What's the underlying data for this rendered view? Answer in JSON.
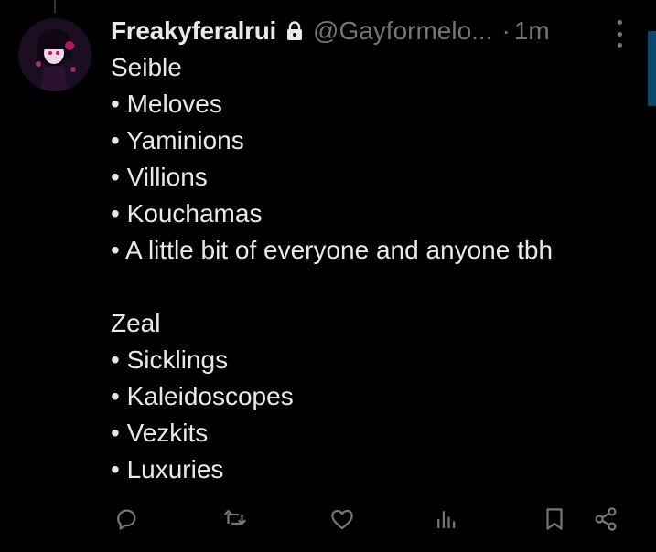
{
  "tweet": {
    "display_name": "Freakyferalrui",
    "handle": "@Gayformelo...",
    "separator": "·",
    "time": "1m",
    "lines": [
      "Seible",
      "• Meloves",
      "• Yaminions",
      "• Villions",
      "• Kouchamas",
      "• A little bit of everyone and anyone tbh",
      "",
      "Zeal",
      "• Sicklings",
      "• Kaleidoscopes",
      "• Vezkits",
      "• Luxuries"
    ]
  },
  "icons": {
    "lock": "lock-icon",
    "more": "more-vertical-icon",
    "reply": "reply-icon",
    "retweet": "retweet-icon",
    "like": "heart-icon",
    "views": "analytics-icon",
    "bookmark": "bookmark-icon",
    "share": "share-icon"
  },
  "colors": {
    "background": "#000000",
    "text": "#e7e9ea",
    "muted": "#71767b"
  }
}
